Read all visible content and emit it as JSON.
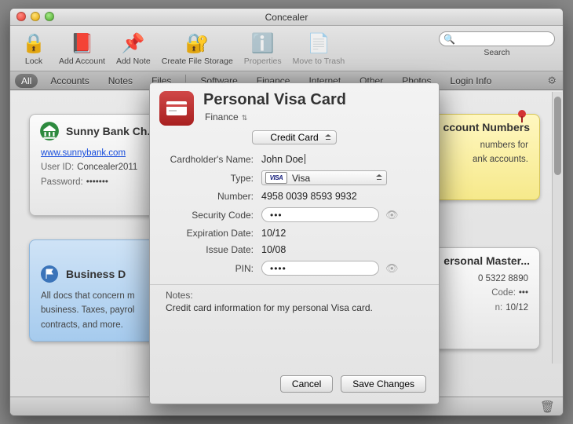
{
  "window": {
    "title": "Concealer"
  },
  "toolbar": {
    "lock": "Lock",
    "add_account": "Add Account",
    "add_note": "Add Note",
    "create_storage": "Create File Storage",
    "properties": "Properties",
    "move_trash": "Move to Trash",
    "search_label": "Search",
    "search_value": ""
  },
  "tabs": {
    "all": "All",
    "accounts": "Accounts",
    "notes": "Notes",
    "files": "Files",
    "software": "Software",
    "finance": "Finance",
    "internet": "Internet",
    "other": "Other",
    "photos": "Photos",
    "login": "Login Info"
  },
  "cards": {
    "bank": {
      "title": "Sunny Bank Ch...",
      "url": "www.sunnybank.com",
      "userid_label": "User ID:",
      "userid_value": "Concealer2011",
      "password_label": "Password:",
      "password_value": "•••••••"
    },
    "numbers_note": {
      "title": "ccount Numbers",
      "line1": "numbers for",
      "line2": "ank accounts."
    },
    "folder": {
      "title": "Business D",
      "body": "All docs that concern m\nbusiness. Taxes, payrol\ncontracts, and more."
    },
    "master": {
      "title": "ersonal Master...",
      "number": "0 5322 8890",
      "code_label": "Code:",
      "code_value": "•••",
      "exp_label": "n:",
      "exp_value": "10/12"
    }
  },
  "sheet": {
    "title": "Personal Visa Card",
    "category": "Finance",
    "record_type": "Credit Card",
    "labels": {
      "cardholder": "Cardholder's Name:",
      "type": "Type:",
      "number": "Number:",
      "seccode": "Security Code:",
      "expiration": "Expiration Date:",
      "issue": "Issue Date:",
      "pin": "PIN:",
      "notes": "Notes:"
    },
    "values": {
      "cardholder": "John Doe",
      "type_badge": "VISA",
      "type": "Visa",
      "number": "4958 0039 8593 9932",
      "seccode": "•••",
      "expiration": "10/12",
      "issue": "10/08",
      "pin": "••••",
      "notes": "Credit card information for my personal Visa card."
    },
    "buttons": {
      "cancel": "Cancel",
      "save": "Save Changes"
    }
  }
}
